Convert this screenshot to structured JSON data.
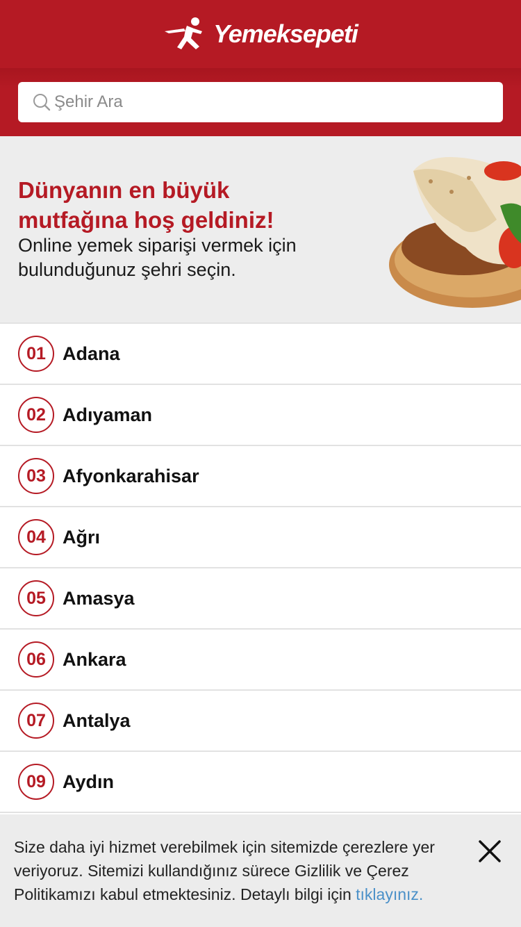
{
  "header": {
    "brand": "Yemeksepeti"
  },
  "search": {
    "placeholder": "Şehir Ara"
  },
  "hero": {
    "title": "Dünyanın en büyük mutfağına hoş geldiniz!",
    "subtitle": "Online yemek siparişi vermek için bulunduğunuz şehri seçin."
  },
  "cities": [
    {
      "plate": "01",
      "name": "Adana"
    },
    {
      "plate": "02",
      "name": "Adıyaman"
    },
    {
      "plate": "03",
      "name": "Afyonkarahisar"
    },
    {
      "plate": "04",
      "name": "Ağrı"
    },
    {
      "plate": "05",
      "name": "Amasya"
    },
    {
      "plate": "06",
      "name": "Ankara"
    },
    {
      "plate": "07",
      "name": "Antalya"
    },
    {
      "plate": "09",
      "name": "Aydın"
    }
  ],
  "cookie": {
    "text": "Size daha iyi hizmet verebilmek için sitemizde çerezlere yer veriyoruz. Sitemizi kullandığınız sürece Gizlilik ve Çerez Politikamızı kabul etmektesiniz. Detaylı bilgi için",
    "link": "tıklayınız."
  },
  "icons": {
    "logo": "running-courier-icon",
    "search": "search-icon",
    "close": "close-icon"
  },
  "colors": {
    "brand_red": "#b51a24",
    "link_blue": "#4a90c8"
  }
}
